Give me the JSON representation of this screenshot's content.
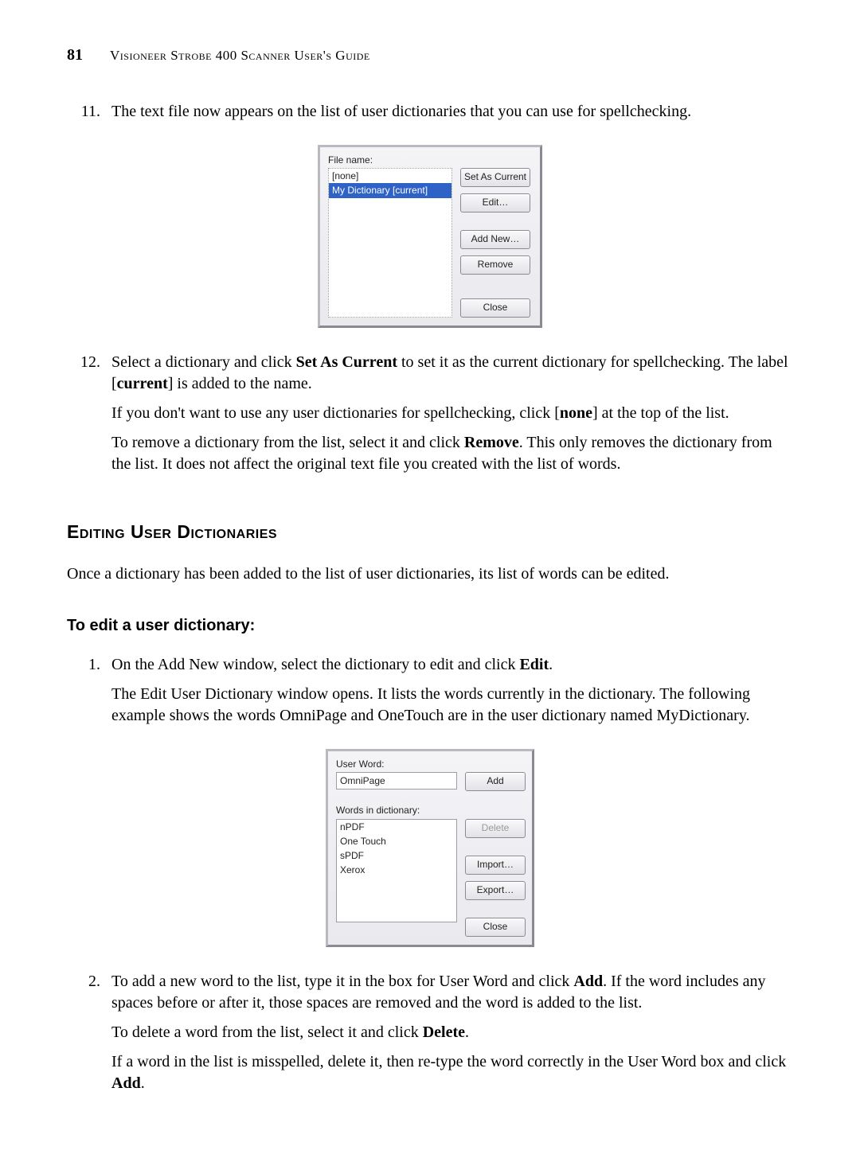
{
  "header": {
    "page_number": "81",
    "title": "Visioneer Strobe 400 Scanner User's Guide"
  },
  "steps_top": {
    "s11": {
      "num": "11.",
      "text": "The text file now appears on the list of user dictionaries that you can use for spellchecking."
    },
    "s12": {
      "num": "12.",
      "p1_a": "Select a dictionary and click ",
      "p1_b": "Set As Current",
      "p1_c": " to set it as the current dictionary for spellchecking. The label [",
      "p1_d": "current",
      "p1_e": "] is added to the name.",
      "p2_a": "If you don't want to use any user dictionaries for spellchecking, click [",
      "p2_b": "none",
      "p2_c": "] at the top of the list.",
      "p3_a": "To remove a dictionary from the list, select it and click ",
      "p3_b": "Remove",
      "p3_c": ". This only removes the dictionary from the list. It does not affect the original text file you created with the list of words."
    }
  },
  "dialog1": {
    "file_name_label": "File name:",
    "items": {
      "none": "[none]",
      "my_dict": "My Dictionary [current]"
    },
    "buttons": {
      "set_current": "Set As Current",
      "edit": "Edit…",
      "add_new": "Add New…",
      "remove": "Remove",
      "close": "Close"
    }
  },
  "section_heading": "Editing User Dictionaries",
  "intro_para": "Once a dictionary has been added to the list of user dictionaries, its list of words can be edited.",
  "sub_heading": "To edit a user dictionary:",
  "steps_bottom": {
    "s1": {
      "num": "1.",
      "p1_a": "On the Add New window, select the dictionary to edit and click ",
      "p1_b": "Edit",
      "p1_c": ".",
      "p2": "The Edit User Dictionary window opens. It lists the words currently in the dictionary. The following example shows the words OmniPage and OneTouch are in the user dictionary named MyDictionary."
    },
    "s2": {
      "num": "2.",
      "p1_a": "To add a new word to the list, type it in the box for User Word and click ",
      "p1_b": "Add",
      "p1_c": ". If the word includes any spaces before or after it, those spaces are removed and the word is added to the list.",
      "p2_a": "To delete a word from the list, select it and click ",
      "p2_b": "Delete",
      "p2_c": ".",
      "p3_a": "If a word in the list is misspelled, delete it, then re-type the word correctly in the User Word box and click ",
      "p3_b": "Add",
      "p3_c": "."
    }
  },
  "dialog2": {
    "user_word_label": "User Word:",
    "user_word_value": "OmniPage",
    "words_in_dict_label": "Words in dictionary:",
    "words": {
      "w1": "nPDF",
      "w2": "One Touch",
      "w3": "sPDF",
      "w4": "Xerox"
    },
    "buttons": {
      "add": "Add",
      "delete": "Delete",
      "import": "Import…",
      "export": "Export…",
      "close": "Close"
    }
  }
}
